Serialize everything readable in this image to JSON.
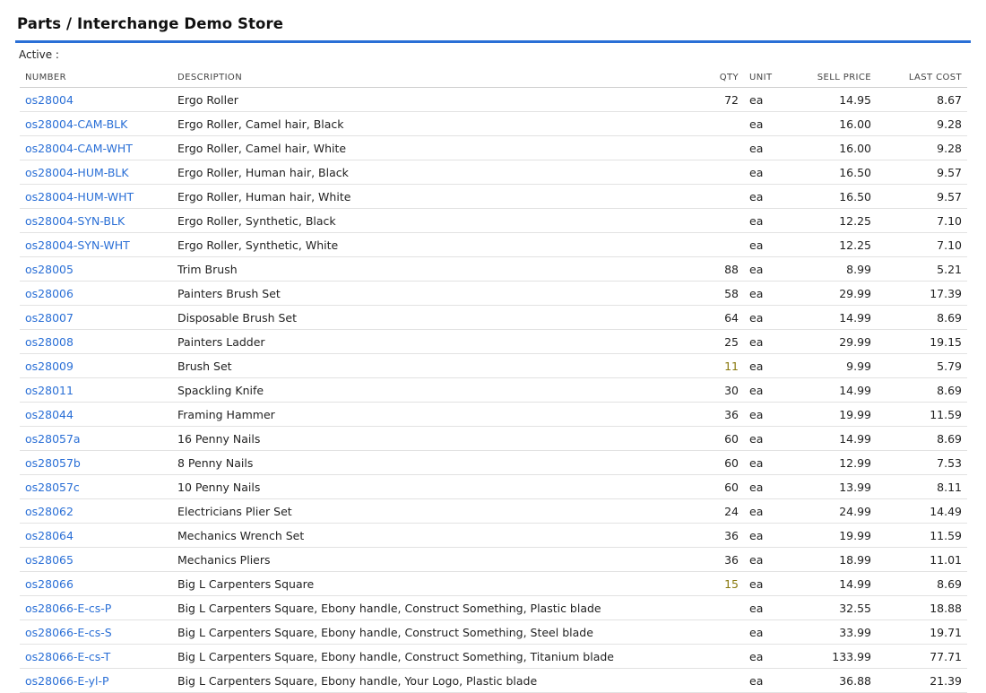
{
  "page": {
    "title": "Parts / Interchange Demo Store",
    "active_label": "Active :"
  },
  "colors": {
    "link": "#2a6fd6",
    "accent_rule": "#2a6fd6",
    "low_qty": "#8a7a10"
  },
  "table": {
    "headers": {
      "number": "NUMBER",
      "description": "DESCRIPTION",
      "qty": "QTY",
      "unit": "UNIT",
      "sell_price": "SELL PRICE",
      "last_cost": "LAST COST"
    },
    "rows": [
      {
        "number": "os28004",
        "description": "Ergo Roller",
        "qty": "72",
        "qty_low": false,
        "unit": "ea",
        "sell": "14.95",
        "cost": "8.67"
      },
      {
        "number": "os28004-CAM-BLK",
        "description": "Ergo Roller, Camel hair, Black",
        "qty": "",
        "qty_low": false,
        "unit": "ea",
        "sell": "16.00",
        "cost": "9.28"
      },
      {
        "number": "os28004-CAM-WHT",
        "description": "Ergo Roller, Camel hair, White",
        "qty": "",
        "qty_low": false,
        "unit": "ea",
        "sell": "16.00",
        "cost": "9.28"
      },
      {
        "number": "os28004-HUM-BLK",
        "description": "Ergo Roller, Human hair, Black",
        "qty": "",
        "qty_low": false,
        "unit": "ea",
        "sell": "16.50",
        "cost": "9.57"
      },
      {
        "number": "os28004-HUM-WHT",
        "description": "Ergo Roller, Human hair, White",
        "qty": "",
        "qty_low": false,
        "unit": "ea",
        "sell": "16.50",
        "cost": "9.57"
      },
      {
        "number": "os28004-SYN-BLK",
        "description": "Ergo Roller, Synthetic, Black",
        "qty": "",
        "qty_low": false,
        "unit": "ea",
        "sell": "12.25",
        "cost": "7.10"
      },
      {
        "number": "os28004-SYN-WHT",
        "description": "Ergo Roller, Synthetic, White",
        "qty": "",
        "qty_low": false,
        "unit": "ea",
        "sell": "12.25",
        "cost": "7.10"
      },
      {
        "number": "os28005",
        "description": "Trim Brush",
        "qty": "88",
        "qty_low": false,
        "unit": "ea",
        "sell": "8.99",
        "cost": "5.21"
      },
      {
        "number": "os28006",
        "description": "Painters Brush Set",
        "qty": "58",
        "qty_low": false,
        "unit": "ea",
        "sell": "29.99",
        "cost": "17.39"
      },
      {
        "number": "os28007",
        "description": "Disposable Brush Set",
        "qty": "64",
        "qty_low": false,
        "unit": "ea",
        "sell": "14.99",
        "cost": "8.69"
      },
      {
        "number": "os28008",
        "description": "Painters Ladder",
        "qty": "25",
        "qty_low": false,
        "unit": "ea",
        "sell": "29.99",
        "cost": "19.15"
      },
      {
        "number": "os28009",
        "description": "Brush Set",
        "qty": "11",
        "qty_low": true,
        "unit": "ea",
        "sell": "9.99",
        "cost": "5.79"
      },
      {
        "number": "os28011",
        "description": "Spackling Knife",
        "qty": "30",
        "qty_low": false,
        "unit": "ea",
        "sell": "14.99",
        "cost": "8.69"
      },
      {
        "number": "os28044",
        "description": "Framing Hammer",
        "qty": "36",
        "qty_low": false,
        "unit": "ea",
        "sell": "19.99",
        "cost": "11.59"
      },
      {
        "number": "os28057a",
        "description": "16 Penny Nails",
        "qty": "60",
        "qty_low": false,
        "unit": "ea",
        "sell": "14.99",
        "cost": "8.69"
      },
      {
        "number": "os28057b",
        "description": "8 Penny Nails",
        "qty": "60",
        "qty_low": false,
        "unit": "ea",
        "sell": "12.99",
        "cost": "7.53"
      },
      {
        "number": "os28057c",
        "description": "10 Penny Nails",
        "qty": "60",
        "qty_low": false,
        "unit": "ea",
        "sell": "13.99",
        "cost": "8.11"
      },
      {
        "number": "os28062",
        "description": "Electricians Plier Set",
        "qty": "24",
        "qty_low": false,
        "unit": "ea",
        "sell": "24.99",
        "cost": "14.49"
      },
      {
        "number": "os28064",
        "description": "Mechanics Wrench Set",
        "qty": "36",
        "qty_low": false,
        "unit": "ea",
        "sell": "19.99",
        "cost": "11.59"
      },
      {
        "number": "os28065",
        "description": "Mechanics Pliers",
        "qty": "36",
        "qty_low": false,
        "unit": "ea",
        "sell": "18.99",
        "cost": "11.01"
      },
      {
        "number": "os28066",
        "description": "Big L Carpenters Square",
        "qty": "15",
        "qty_low": true,
        "unit": "ea",
        "sell": "14.99",
        "cost": "8.69"
      },
      {
        "number": "os28066-E-cs-P",
        "description": "Big L Carpenters Square, Ebony handle, Construct Something, Plastic blade",
        "qty": "",
        "qty_low": false,
        "unit": "ea",
        "sell": "32.55",
        "cost": "18.88"
      },
      {
        "number": "os28066-E-cs-S",
        "description": "Big L Carpenters Square, Ebony handle, Construct Something, Steel blade",
        "qty": "",
        "qty_low": false,
        "unit": "ea",
        "sell": "33.99",
        "cost": "19.71"
      },
      {
        "number": "os28066-E-cs-T",
        "description": "Big L Carpenters Square, Ebony handle, Construct Something, Titanium blade",
        "qty": "",
        "qty_low": false,
        "unit": "ea",
        "sell": "133.99",
        "cost": "77.71"
      },
      {
        "number": "os28066-E-yl-P",
        "description": "Big L Carpenters Square, Ebony handle, Your Logo, Plastic blade",
        "qty": "",
        "qty_low": false,
        "unit": "ea",
        "sell": "36.88",
        "cost": "21.39"
      }
    ]
  }
}
